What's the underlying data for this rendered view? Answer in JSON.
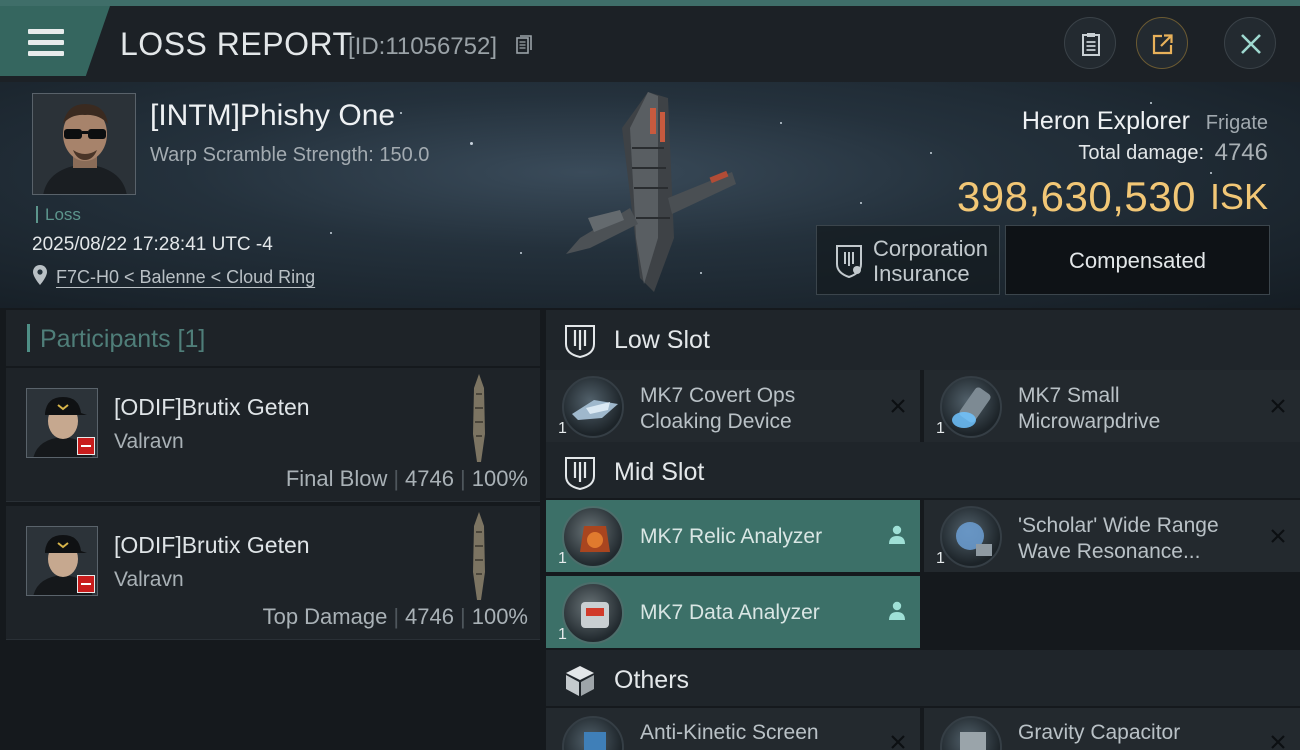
{
  "header": {
    "title": "LOSS REPORT",
    "report_id": "[ID:11056752]"
  },
  "victim": {
    "name": "[INTM]Phishy One",
    "warp_scramble": "Warp Scramble Strength: 150.0",
    "status": "Loss",
    "timestamp": "2025/08/22 17:28:41 UTC -4",
    "location": "F7C-H0 < Balenne < Cloud Ring"
  },
  "ship": {
    "name": "Heron Explorer",
    "class": "Frigate",
    "damage_label": "Total damage:",
    "damage_value": "4746",
    "isk_value": "398,630,530",
    "isk_unit": "ISK"
  },
  "actions": {
    "insurance_label": "Corporation Insurance",
    "compensated_label": "Compensated"
  },
  "participants": {
    "title": "Participants [1]",
    "rows": [
      {
        "name": "[ODIF]Brutix Geten",
        "corp": "Valravn",
        "role": "Final Blow",
        "damage": "4746",
        "percent": "100%"
      },
      {
        "name": "[ODIF]Brutix Geten",
        "corp": "Valravn",
        "role": "Top Damage",
        "damage": "4746",
        "percent": "100%"
      }
    ]
  },
  "fittings": {
    "low_slot_label": "Low Slot",
    "mid_slot_label": "Mid Slot",
    "others_label": "Others",
    "low": [
      {
        "name": "MK7 Covert Ops Cloaking Device",
        "qty": "1"
      },
      {
        "name": "MK7 Small Microwarpdrive",
        "qty": "1"
      }
    ],
    "mid": [
      {
        "name": "MK7 Relic Analyzer",
        "qty": "1"
      },
      {
        "name": "'Scholar' Wide Range Wave Resonance...",
        "qty": "1"
      },
      {
        "name": "MK7 Data Analyzer",
        "qty": "1"
      }
    ],
    "others": [
      {
        "name": "Anti-Kinetic Screen"
      },
      {
        "name": "Gravity Capacitor"
      }
    ]
  },
  "colors": {
    "accent": "#3c7068",
    "isk": "#f2c776",
    "background": "#15191d"
  }
}
